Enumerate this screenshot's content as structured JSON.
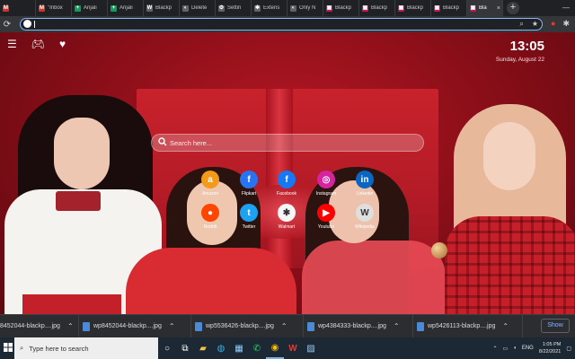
{
  "browser": {
    "tabs": [
      {
        "label": "",
        "favicon": "M",
        "color": "#d93025"
      },
      {
        "label": "\"Inbox",
        "favicon": "M",
        "color": "#d93025"
      },
      {
        "label": "Anjali",
        "favicon": "+",
        "color": "#0f9d58"
      },
      {
        "label": "Anjali",
        "favicon": "+",
        "color": "#0f9d58"
      },
      {
        "label": "Blackp",
        "favicon": "W",
        "color": "#5f6368"
      },
      {
        "label": "Delete",
        "favicon": "◐",
        "color": "#5f6368"
      },
      {
        "label": "Settin",
        "favicon": "⚙",
        "color": "#5f6368"
      },
      {
        "label": "Extens",
        "favicon": "✱",
        "color": "#5f6368"
      },
      {
        "label": "Only N",
        "favicon": "◐",
        "color": "#5f6368"
      },
      {
        "label": "Blackp",
        "favicon": "▣",
        "color": "#c2185b"
      },
      {
        "label": "Blackp",
        "favicon": "▣",
        "color": "#c2185b"
      },
      {
        "label": "Blackp",
        "favicon": "▣",
        "color": "#c2185b"
      },
      {
        "label": "Blackp",
        "favicon": "▣",
        "color": "#c2185b"
      },
      {
        "label": "Bla",
        "favicon": "▣",
        "color": "#c2185b"
      }
    ],
    "tab_close": "×",
    "new_tab": "+",
    "omnibox_value": ""
  },
  "page": {
    "time": "13:05",
    "date": "Sunday, August 22",
    "search_placeholder": "Search here...",
    "shortcuts": [
      {
        "label": "Amazon",
        "glyph": "a",
        "color": "#f29a1a"
      },
      {
        "label": "Flipkart",
        "glyph": "f",
        "color": "#2874f0"
      },
      {
        "label": "Facebook",
        "glyph": "f",
        "color": "#1877f2"
      },
      {
        "label": "Instagram",
        "glyph": "◎",
        "color": "#d6249f"
      },
      {
        "label": "Linkedin",
        "glyph": "in",
        "color": "#0a66c2"
      },
      {
        "label": "Reddit",
        "glyph": "●",
        "color": "#ff4500"
      },
      {
        "label": "Twitter",
        "glyph": "t",
        "color": "#1da1f2"
      },
      {
        "label": "Walmart",
        "glyph": "✱",
        "color": "#f6f6f6"
      },
      {
        "label": "Youtube",
        "glyph": "▶",
        "color": "#ff0000"
      },
      {
        "label": "Wikipedia",
        "glyph": "W",
        "color": "#dedede"
      }
    ]
  },
  "downloads": {
    "items": [
      "8452044-blackp....jpg",
      "wp8452044-blackp....jpg",
      "wp5536426-blackp....jpg",
      "wp4384333-blackp....jpg",
      "wp5426113-blackp....jpg"
    ],
    "show_all": "Show"
  },
  "taskbar": {
    "search_placeholder": "Type here to search",
    "time": "1:05 PM",
    "date": "8/22/2021",
    "lang": "ENG"
  }
}
